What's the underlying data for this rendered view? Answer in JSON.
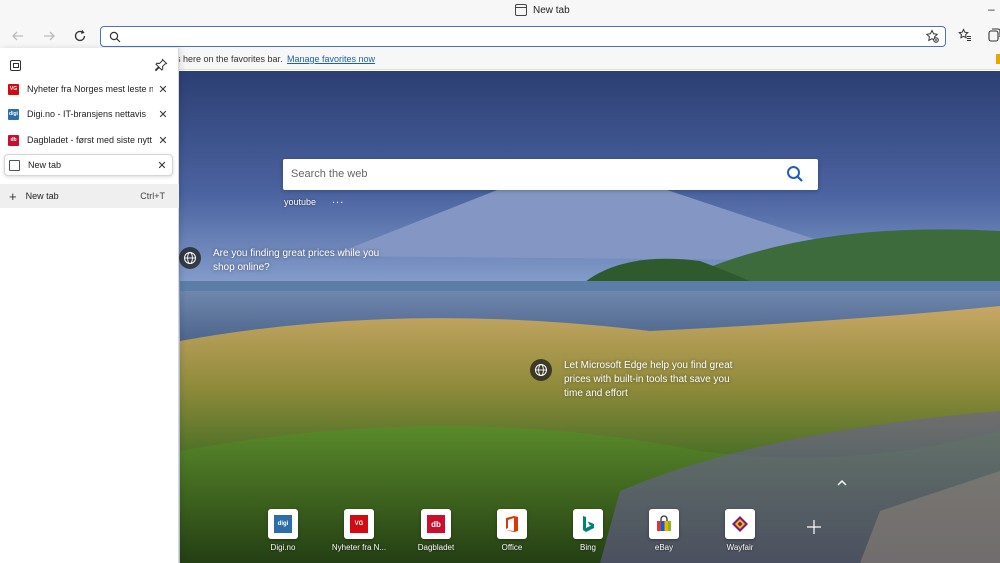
{
  "window": {
    "title": "New tab"
  },
  "toolbar": {
    "address_value": ""
  },
  "favorites_bar": {
    "message": "s here on the favorites bar.",
    "link": "Manage favorites now"
  },
  "tabs_panel": {
    "tabs": [
      {
        "label": "Nyheter fra Norges mest leste ne",
        "favicon": "VG",
        "favicon_color": "#d20a11"
      },
      {
        "label": "Digi.no - IT-bransjens nettavis",
        "favicon": "digi",
        "favicon_color": "#2e6ea6"
      },
      {
        "label": "Dagbladet - først med siste nytt",
        "favicon": "db",
        "favicon_color": "#c8102e"
      },
      {
        "label": "New tab",
        "favicon": "newtab",
        "favicon_color": "#ffffff",
        "active": true
      }
    ],
    "new_tab": {
      "label": "New tab",
      "shortcut": "Ctrl+T"
    }
  },
  "new_tab_page": {
    "search_placeholder": "Search the web",
    "suggestion": "youtube",
    "more": "...",
    "promo1": {
      "line1": "Are you finding great prices while you",
      "line2": "shop online?"
    },
    "promo2": {
      "line1": "Let Microsoft Edge help you find great",
      "line2": "prices with built-in tools that save you",
      "line3": "time and effort"
    },
    "quick_links": [
      {
        "label": "Digi.no",
        "icon": "digi",
        "color": "#2e6ea6"
      },
      {
        "label": "Nyheter fra N...",
        "icon": "VG",
        "color": "#d20a11"
      },
      {
        "label": "Dagbladet",
        "icon": "db",
        "color": "#c8102e"
      },
      {
        "label": "Office",
        "icon": "office",
        "color": "#d83b01"
      },
      {
        "label": "Bing",
        "icon": "bing",
        "color": "#008373"
      },
      {
        "label": "eBay",
        "icon": "ebay",
        "color": "#e53238"
      },
      {
        "label": "Wayfair",
        "icon": "wayfair",
        "color": "#7f187f"
      }
    ]
  },
  "colors": {
    "accent": "#4f6fbf",
    "link": "#1a5fb4"
  }
}
